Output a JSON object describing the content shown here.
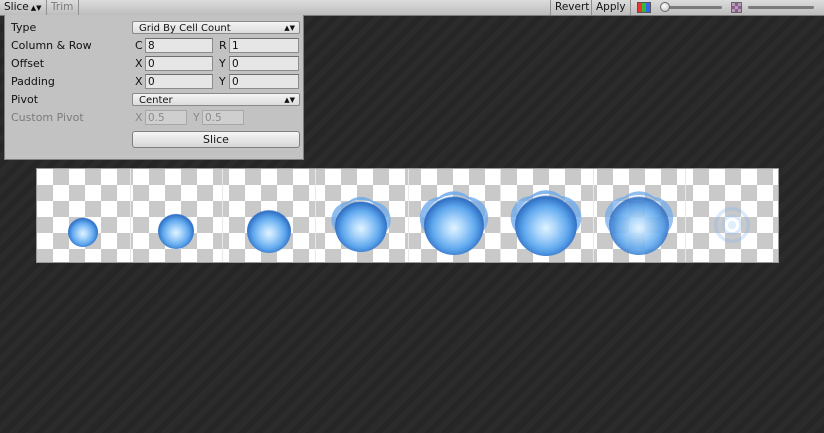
{
  "toolbar": {
    "slice_label": "Slice",
    "trim_label": "Trim",
    "revert_label": "Revert",
    "apply_label": "Apply",
    "icons": [
      "rgb-channel-icon",
      "zoom-slider",
      "mip-level-icon"
    ]
  },
  "panel": {
    "type": {
      "label": "Type",
      "value": "Grid By Cell Count"
    },
    "column_row": {
      "label": "Column & Row",
      "c_axis": "C",
      "c_value": "8",
      "r_axis": "R",
      "r_value": "1"
    },
    "offset": {
      "label": "Offset",
      "x_axis": "X",
      "x_value": "0",
      "y_axis": "Y",
      "y_value": "0"
    },
    "padding": {
      "label": "Padding",
      "x_axis": "X",
      "x_value": "0",
      "y_axis": "Y",
      "y_value": "0"
    },
    "pivot": {
      "label": "Pivot",
      "value": "Center"
    },
    "custom_pivot": {
      "label": "Custom Pivot",
      "x_axis": "X",
      "x_value": "0.5",
      "y_axis": "Y",
      "y_value": "0.5"
    },
    "slice_button": "Slice"
  },
  "sprite_sheet": {
    "cells": 8,
    "colors": {
      "core": "#dff3ff",
      "mid": "#5fa8ee",
      "edge": "#2f6fc4"
    }
  }
}
